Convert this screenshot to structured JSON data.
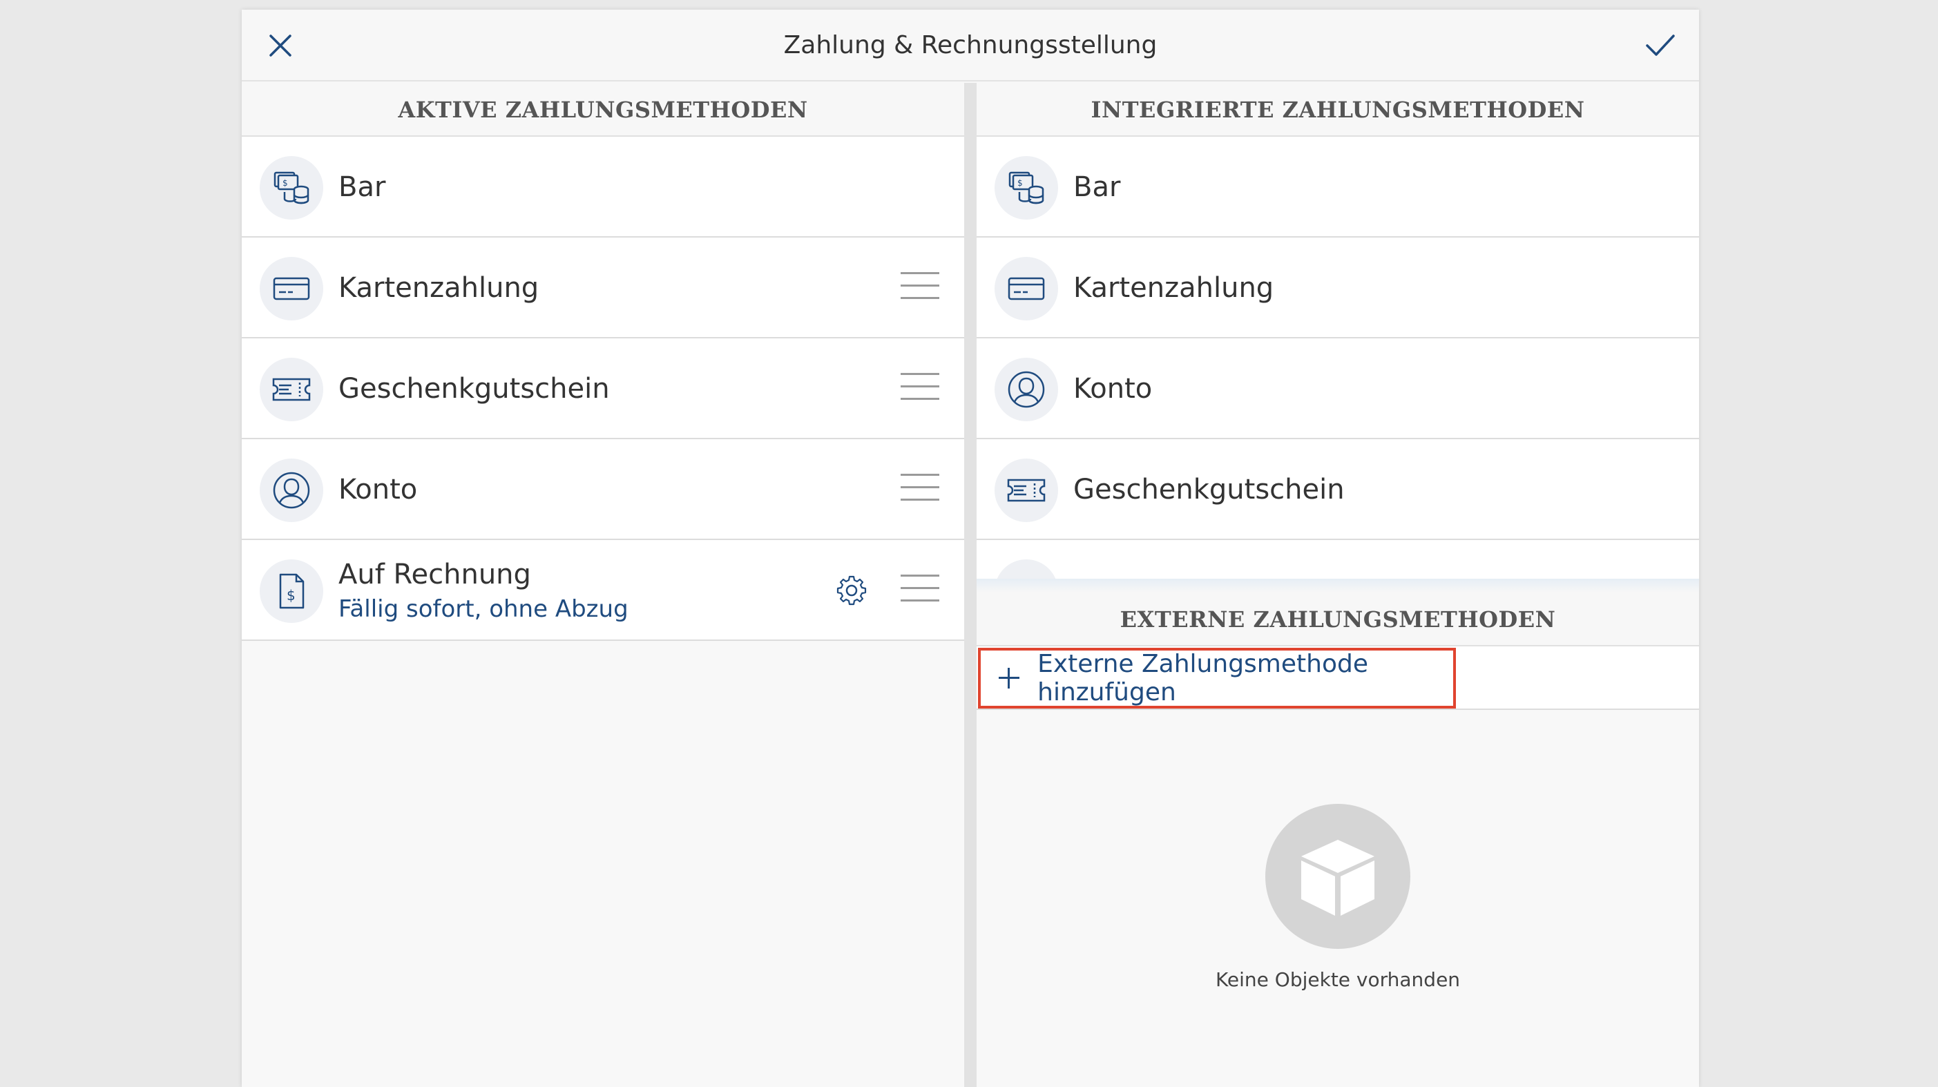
{
  "header": {
    "title": "Zahlung & Rechnungsstellung",
    "close_icon": "close-icon",
    "confirm_icon": "checkmark-icon"
  },
  "colors": {
    "accent": "#1f4b7f",
    "highlight_border": "#e0442f",
    "background": "#e9e9e9"
  },
  "active_methods": {
    "header": "AKTIVE ZAHLUNGSMETHODEN",
    "items": [
      {
        "label": "Bar",
        "icon": "cash-icon"
      },
      {
        "label": "Kartenzahlung",
        "icon": "credit-card-icon"
      },
      {
        "label": "Geschenkgutschein",
        "icon": "gift-voucher-icon"
      },
      {
        "label": "Konto",
        "icon": "account-icon"
      },
      {
        "label": "Auf Rechnung",
        "sublabel": "Fällig sofort, ohne Abzug",
        "icon": "invoice-icon"
      }
    ]
  },
  "integrated_methods": {
    "header": "INTEGRIERTE ZAHLUNGSMETHODEN",
    "items": [
      {
        "label": "Bar",
        "icon": "cash-icon"
      },
      {
        "label": "Kartenzahlung",
        "icon": "credit-card-icon"
      },
      {
        "label": "Konto",
        "icon": "account-icon"
      },
      {
        "label": "Geschenkgutschein",
        "icon": "gift-voucher-icon"
      }
    ]
  },
  "external_methods": {
    "header": "EXTERNE ZAHLUNGSMETHODEN",
    "add_label": "Externe Zahlungsmethode hinzufügen",
    "empty_text": "Keine Objekte vorhanden",
    "empty_icon": "box-icon"
  }
}
